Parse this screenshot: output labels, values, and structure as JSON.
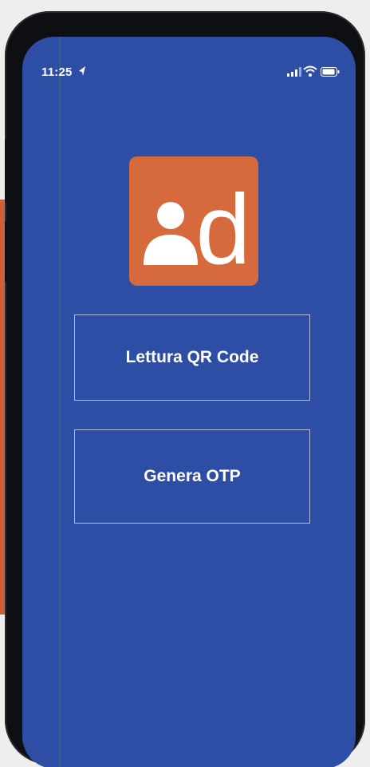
{
  "status_bar": {
    "time": "11:25",
    "icons": [
      "location-arrow-icon",
      "cellular-signal-icon",
      "wifi-icon",
      "battery-icon"
    ]
  },
  "logo": {
    "icon": "user-d-logo-icon",
    "letter": "d"
  },
  "buttons": {
    "qr_label": "Lettura QR Code",
    "otp_label": "Genera OTP"
  },
  "colors": {
    "screen_bg": "#2d4ea4",
    "logo_bg": "#d66a3c",
    "text": "#ffffff"
  }
}
